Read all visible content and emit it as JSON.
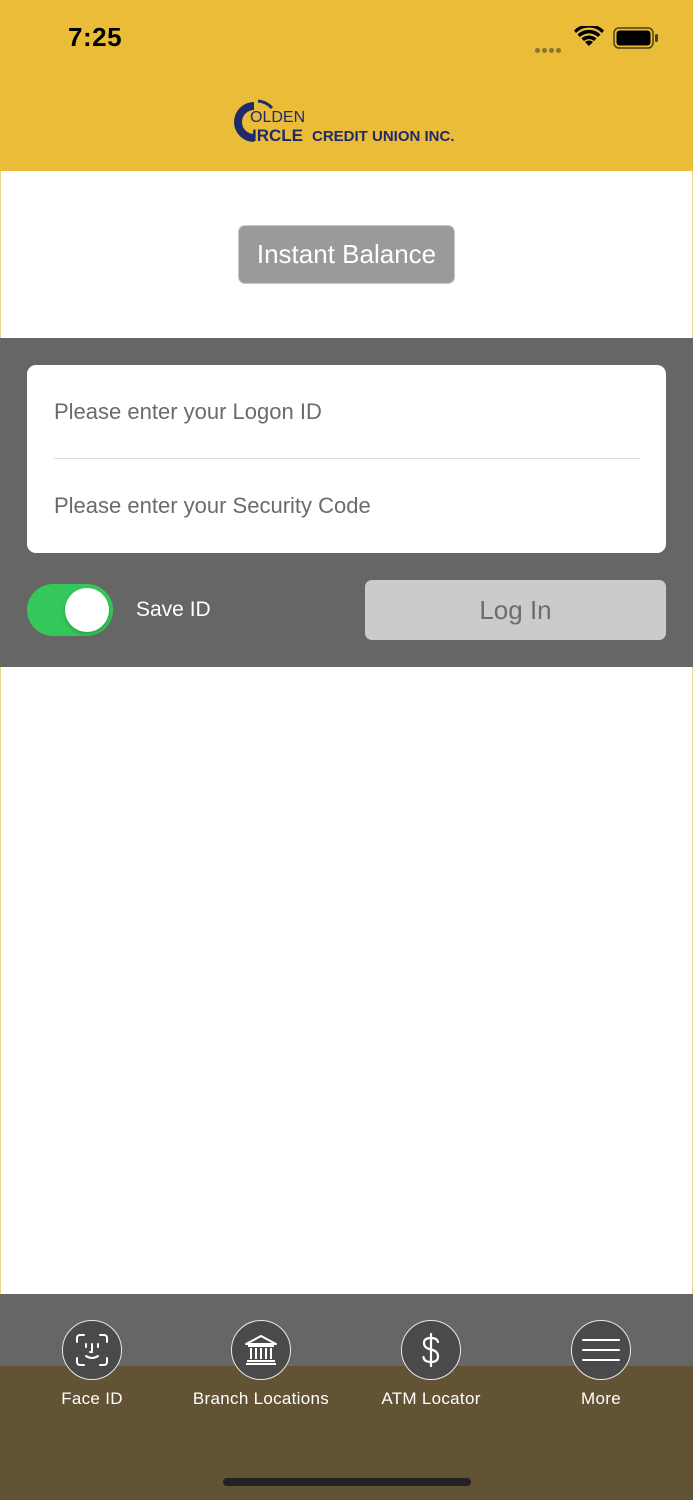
{
  "status_bar": {
    "time": "7:25"
  },
  "header": {
    "logo_text": "GOLDEN CIRCLE CREDIT UNION INC.",
    "brand_color": "#EBBC38"
  },
  "instant_balance": {
    "label": "Instant Balance"
  },
  "login_form": {
    "logon_placeholder": "Please enter your Logon ID",
    "security_placeholder": "Please enter your Security Code",
    "save_id_label": "Save ID",
    "save_id_on": true,
    "login_label": "Log In"
  },
  "tabbar": {
    "items": [
      {
        "label": "Face ID",
        "icon": "face-id-icon"
      },
      {
        "label": "Branch Locations",
        "icon": "bank-icon"
      },
      {
        "label": "ATM Locator",
        "icon": "dollar-icon"
      },
      {
        "label": "More",
        "icon": "menu-icon"
      }
    ]
  },
  "colors": {
    "toggle_on": "#34C759",
    "panel_gray": "#666666",
    "tabbar_bottom": "#615334"
  }
}
